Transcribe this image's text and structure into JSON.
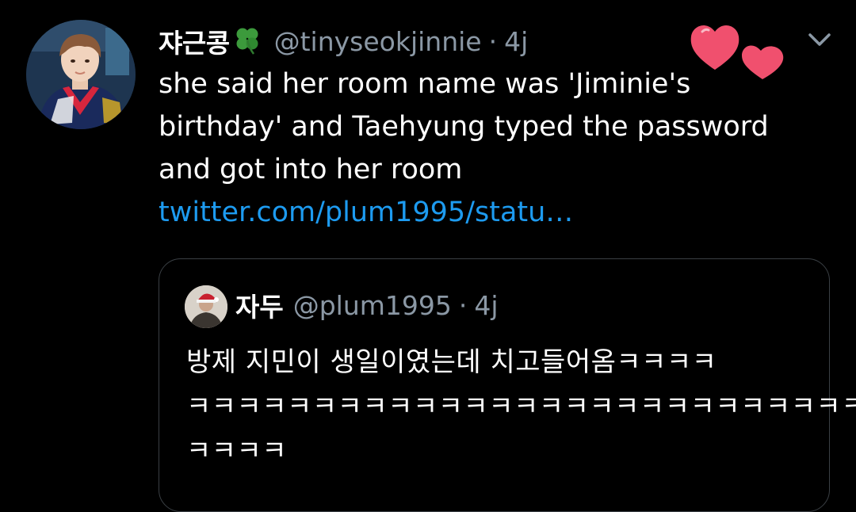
{
  "tweet": {
    "display_name": "쟈근콩",
    "handle": "@tinyseokjinnie",
    "separator": "·",
    "timestamp": "4j",
    "lines": [
      "she said her room name was 'Jiminie's",
      "birthday' and Taehyung typed the password",
      "and got into her room"
    ],
    "link_text": "twitter.com/plum1995/statu…"
  },
  "quote": {
    "display_name": "자두",
    "handle": "@plum1995",
    "separator": "·",
    "timestamp": "4j",
    "lines": [
      "방제 지민이 생일이였는데 치고들어옴ㅋㅋㅋㅋ",
      "ㅋㅋㅋㅋㅋㅋㅋㅋㅋㅋㅋㅋㅋㅋㅋㅋㅋㅋㅋㅋㅋㅋㅋㅋㅋㅋㅋ",
      "ㅋㅋㅋㅋ"
    ]
  },
  "icons": {
    "clover": "clover-icon",
    "hearts": "hearts-sticker",
    "menu": "chevron-down-icon"
  },
  "colors": {
    "background": "#000000",
    "text": "#ffffff",
    "muted": "#8b98a5",
    "link": "#1d9bf0",
    "heart": "#f0506e",
    "clover": "#3c9a3c",
    "border": "#3a3f44"
  }
}
